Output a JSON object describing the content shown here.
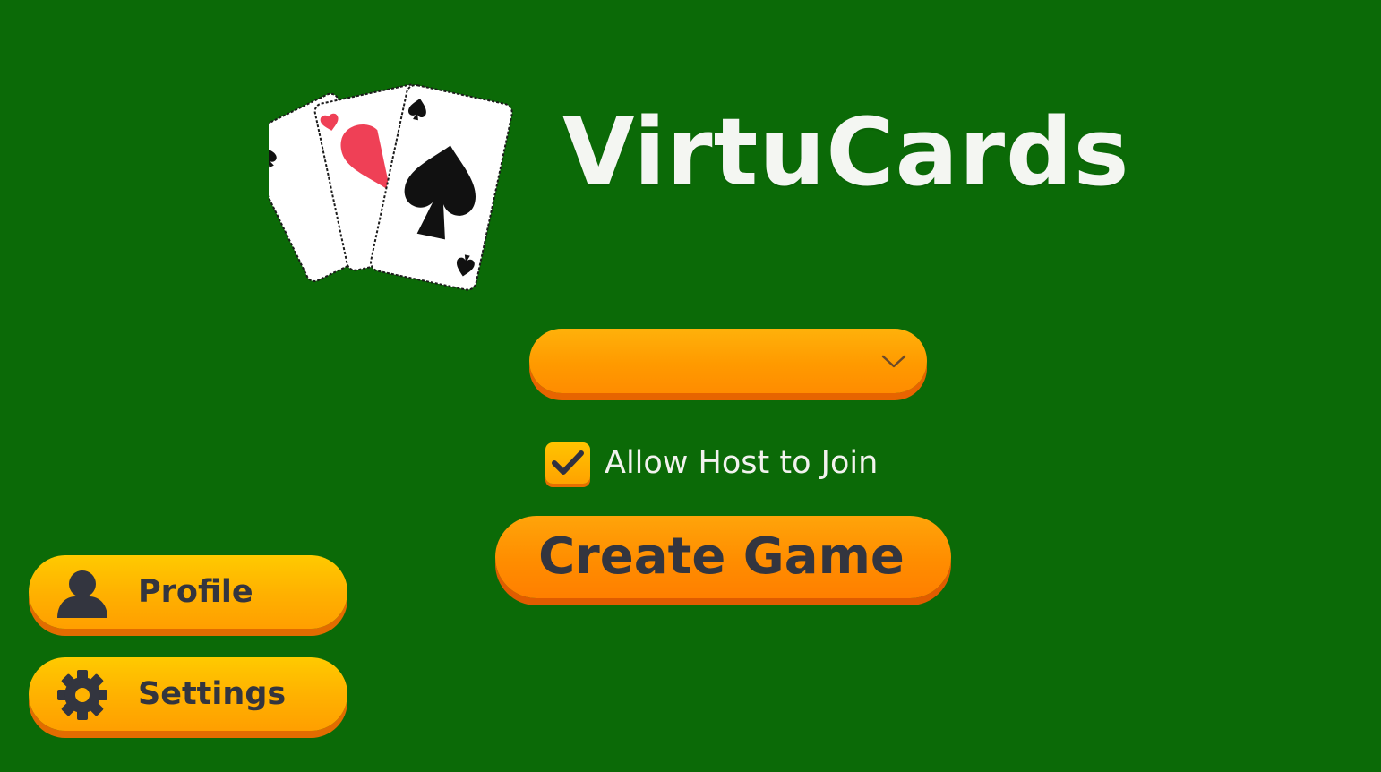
{
  "app": {
    "title": "VirtuCards",
    "background_color": "#0b6a07"
  },
  "logo": {
    "icon": "playing-cards-logo-icon"
  },
  "game_type_dropdown": {
    "selected_value": "",
    "icon": "chevron-down-icon"
  },
  "allow_host_checkbox": {
    "label": "Allow Host to Join",
    "checked": true,
    "icon": "checkmark-icon"
  },
  "create_game_button": {
    "label": "Create Game"
  },
  "side_menu": {
    "profile": {
      "label": "Profile",
      "icon": "user-icon"
    },
    "settings": {
      "label": "Settings",
      "icon": "gear-icon"
    }
  },
  "colors": {
    "accent_orange": "#ff8d00",
    "accent_yellow": "#ffb200",
    "button_text": "#33353f",
    "title_text": "#f4f6f2"
  }
}
